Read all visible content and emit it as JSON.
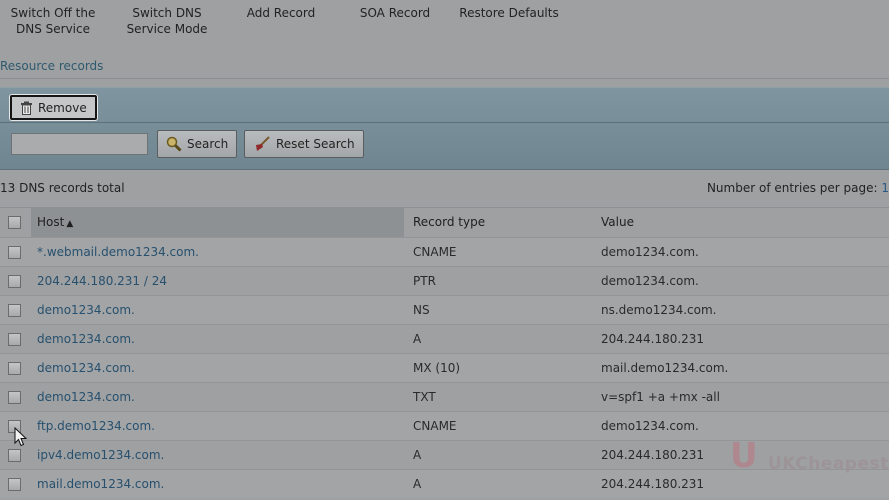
{
  "toolbar": {
    "switch_off": [
      "Switch Off the",
      "DNS Service"
    ],
    "switch_mode": [
      "Switch DNS",
      "Service Mode"
    ],
    "add_record": "Add Record",
    "soa_record": "SOA Record",
    "restore_defaults": "Restore Defaults"
  },
  "section_title": "Resource records",
  "actions": {
    "remove": "Remove"
  },
  "search": {
    "value": "",
    "search_label": "Search",
    "reset_label": "Reset Search"
  },
  "totals": "13 DNS records total",
  "per_page": {
    "label": "Number of entries per page:",
    "value": "1"
  },
  "columns": {
    "host": "Host",
    "type": "Record type",
    "value": "Value"
  },
  "rows": [
    {
      "host": "*.webmail.demo1234.com.",
      "type": "CNAME",
      "value": "demo1234.com."
    },
    {
      "host": "204.244.180.231 / 24",
      "type": "PTR",
      "value": "demo1234.com."
    },
    {
      "host": "demo1234.com.",
      "type": "NS",
      "value": "ns.demo1234.com."
    },
    {
      "host": "demo1234.com.",
      "type": "A",
      "value": "204.244.180.231"
    },
    {
      "host": "demo1234.com.",
      "type": "MX (10)",
      "value": "mail.demo1234.com."
    },
    {
      "host": "demo1234.com.",
      "type": "TXT",
      "value": "v=spf1 +a +mx -all"
    },
    {
      "host": "ftp.demo1234.com.",
      "type": "CNAME",
      "value": "demo1234.com."
    },
    {
      "host": "ipv4.demo1234.com.",
      "type": "A",
      "value": "204.244.180.231"
    },
    {
      "host": "mail.demo1234.com.",
      "type": "A",
      "value": "204.244.180.231"
    }
  ],
  "watermark": "UKCheapest",
  "icons": {
    "remove": "trash-icon",
    "search": "magnifier-icon",
    "reset": "broom-icon",
    "sort": "sort-ascending-icon",
    "cursor": "mouse-pointer-icon"
  }
}
